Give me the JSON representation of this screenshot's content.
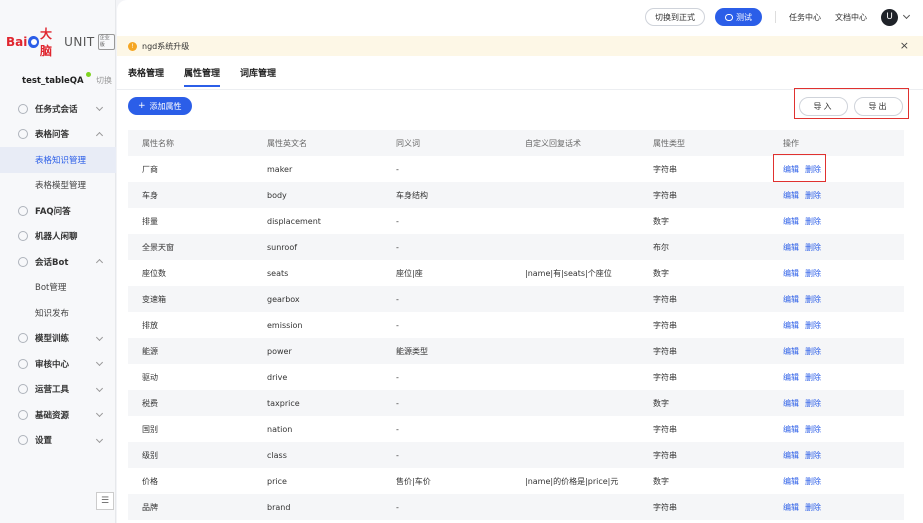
{
  "sidebar": {
    "logo": {
      "bai": "Bai",
      "du": "大脑",
      "unit": "UNIT",
      "badge": "企业版"
    },
    "project": {
      "name": "test_tableQA",
      "switch": "切换"
    },
    "menu": [
      {
        "label": "任务式会话",
        "icon": "task-icon",
        "type": "item",
        "expanded": false
      },
      {
        "label": "表格问答",
        "icon": "table-qa-icon",
        "type": "item",
        "expanded": true
      },
      {
        "label": "表格知识管理",
        "type": "sub",
        "active": true
      },
      {
        "label": "表格模型管理",
        "type": "sub",
        "active": false
      },
      {
        "label": "FAQ问答",
        "icon": "faq-icon",
        "type": "item",
        "noChevron": true
      },
      {
        "label": "机器人闲聊",
        "icon": "chat-icon",
        "type": "item",
        "noChevron": true
      },
      {
        "label": "会话Bot",
        "icon": "bot-icon",
        "type": "item",
        "expanded": true
      },
      {
        "label": "Bot管理",
        "type": "sub",
        "active": false
      },
      {
        "label": "知识发布",
        "type": "sub",
        "active": false
      },
      {
        "label": "模型训练",
        "icon": "train-icon",
        "type": "item",
        "expanded": false
      },
      {
        "label": "审核中心",
        "icon": "review-icon",
        "type": "item",
        "expanded": false
      },
      {
        "label": "运营工具",
        "icon": "tools-icon",
        "type": "item",
        "expanded": false
      },
      {
        "label": "基础资源",
        "icon": "resource-icon",
        "type": "item",
        "expanded": false
      },
      {
        "label": "设置",
        "icon": "settings-icon",
        "type": "item",
        "expanded": false
      }
    ],
    "collapse": "☰"
  },
  "topbar": {
    "switch_formal": "切换到正式",
    "test": "测试",
    "task_center": "任务中心",
    "doc_center": "文档中心",
    "avatar": "U"
  },
  "notice": {
    "text": "ngd系统升级",
    "close": "×"
  },
  "tabs": [
    {
      "label": "表格管理",
      "active": false
    },
    {
      "label": "属性管理",
      "active": true
    },
    {
      "label": "词库管理",
      "active": false
    }
  ],
  "actions": {
    "add": "添加属性",
    "import": "导入",
    "export": "导出"
  },
  "table": {
    "headers": [
      "属性名称",
      "属性英文名",
      "同义词",
      "自定义回复话术",
      "属性类型",
      "操作"
    ],
    "ops": {
      "edit": "编辑",
      "delete": "删除"
    },
    "rows": [
      [
        "厂商",
        "maker",
        "-",
        "",
        "字符串"
      ],
      [
        "车身",
        "body",
        "车身结构",
        "",
        "字符串"
      ],
      [
        "排量",
        "displacement",
        "-",
        "",
        "数字"
      ],
      [
        "全景天窗",
        "sunroof",
        "-",
        "",
        "布尔"
      ],
      [
        "座位数",
        "seats",
        "座位|座",
        "|name|有|seats|个座位",
        "数字"
      ],
      [
        "变速箱",
        "gearbox",
        "-",
        "",
        "字符串"
      ],
      [
        "排放",
        "emission",
        "-",
        "",
        "字符串"
      ],
      [
        "能源",
        "power",
        "能源类型",
        "",
        "字符串"
      ],
      [
        "驱动",
        "drive",
        "-",
        "",
        "字符串"
      ],
      [
        "税费",
        "taxprice",
        "-",
        "",
        "数字"
      ],
      [
        "国别",
        "nation",
        "-",
        "",
        "字符串"
      ],
      [
        "级别",
        "class",
        "-",
        "",
        "字符串"
      ],
      [
        "价格",
        "price",
        "售价|车价",
        "|name|的价格是|price|元",
        "数字"
      ],
      [
        "品牌",
        "brand",
        "-",
        "",
        "字符串"
      ]
    ]
  }
}
